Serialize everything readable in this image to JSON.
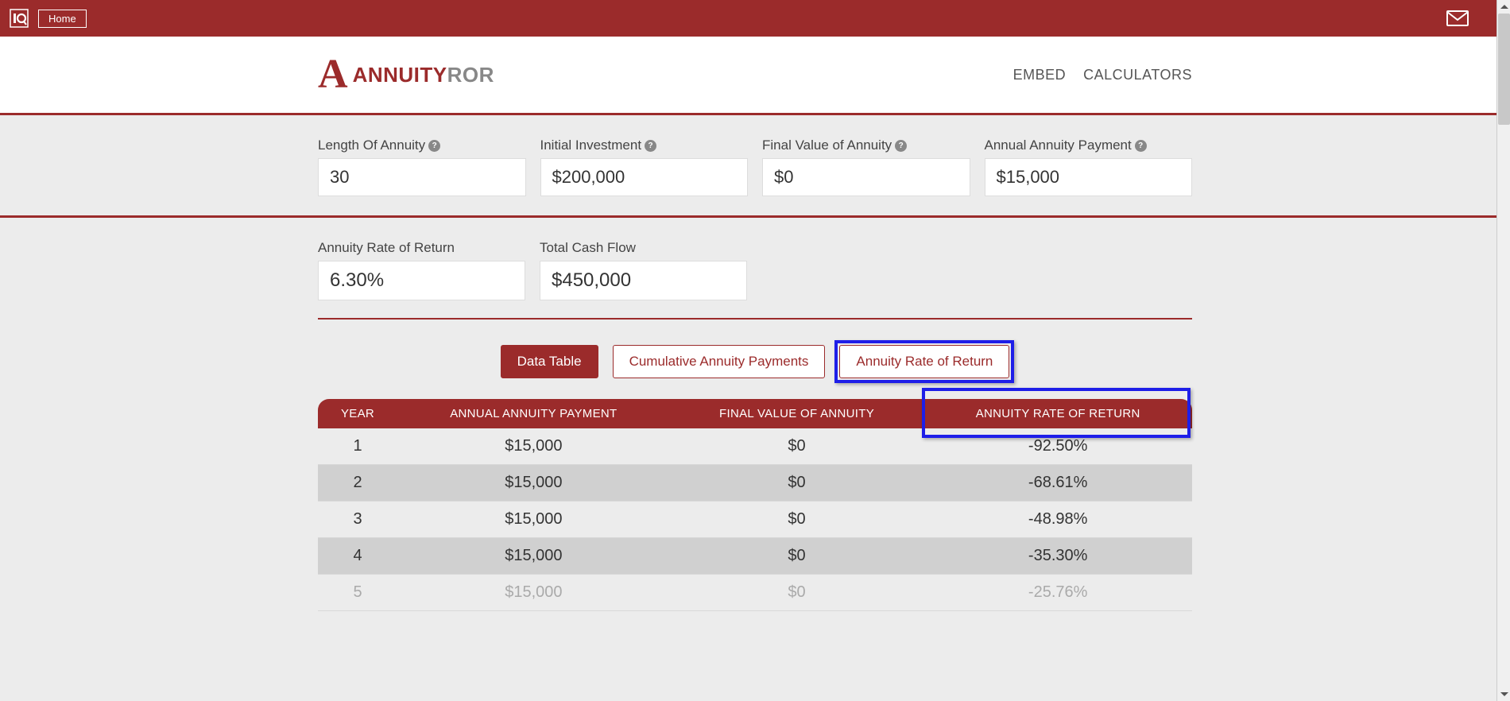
{
  "topbar": {
    "home": "Home"
  },
  "logo": {
    "letter": "A",
    "part1": "ANNUITY",
    "part2": "ROR"
  },
  "nav": {
    "embed": "EMBED",
    "calculators": "CALCULATORS"
  },
  "inputs": {
    "length": {
      "label": "Length Of Annuity",
      "value": "30"
    },
    "initial": {
      "label": "Initial Investment",
      "value": "$200,000"
    },
    "final": {
      "label": "Final Value of Annuity",
      "value": "$0"
    },
    "payment": {
      "label": "Annual Annuity Payment",
      "value": "$15,000"
    }
  },
  "results": {
    "ror": {
      "label": "Annuity Rate of Return",
      "value": "6.30%"
    },
    "cash": {
      "label": "Total Cash Flow",
      "value": "$450,000"
    }
  },
  "tabs": {
    "data": "Data Table",
    "cumulative": "Cumulative Annuity Payments",
    "ror": "Annuity Rate of Return"
  },
  "table": {
    "headers": {
      "year": "YEAR",
      "payment": "ANNUAL ANNUITY PAYMENT",
      "final": "FINAL VALUE OF ANNUITY",
      "ror": "ANNUITY RATE OF RETURN"
    },
    "rows": [
      {
        "year": "1",
        "payment": "$15,000",
        "final": "$0",
        "ror": "-92.50%"
      },
      {
        "year": "2",
        "payment": "$15,000",
        "final": "$0",
        "ror": "-68.61%"
      },
      {
        "year": "3",
        "payment": "$15,000",
        "final": "$0",
        "ror": "-48.98%"
      },
      {
        "year": "4",
        "payment": "$15,000",
        "final": "$0",
        "ror": "-35.30%"
      }
    ],
    "partial": {
      "year": "5",
      "payment": "$15,000",
      "final": "$0",
      "ror": "-25.76%"
    }
  }
}
